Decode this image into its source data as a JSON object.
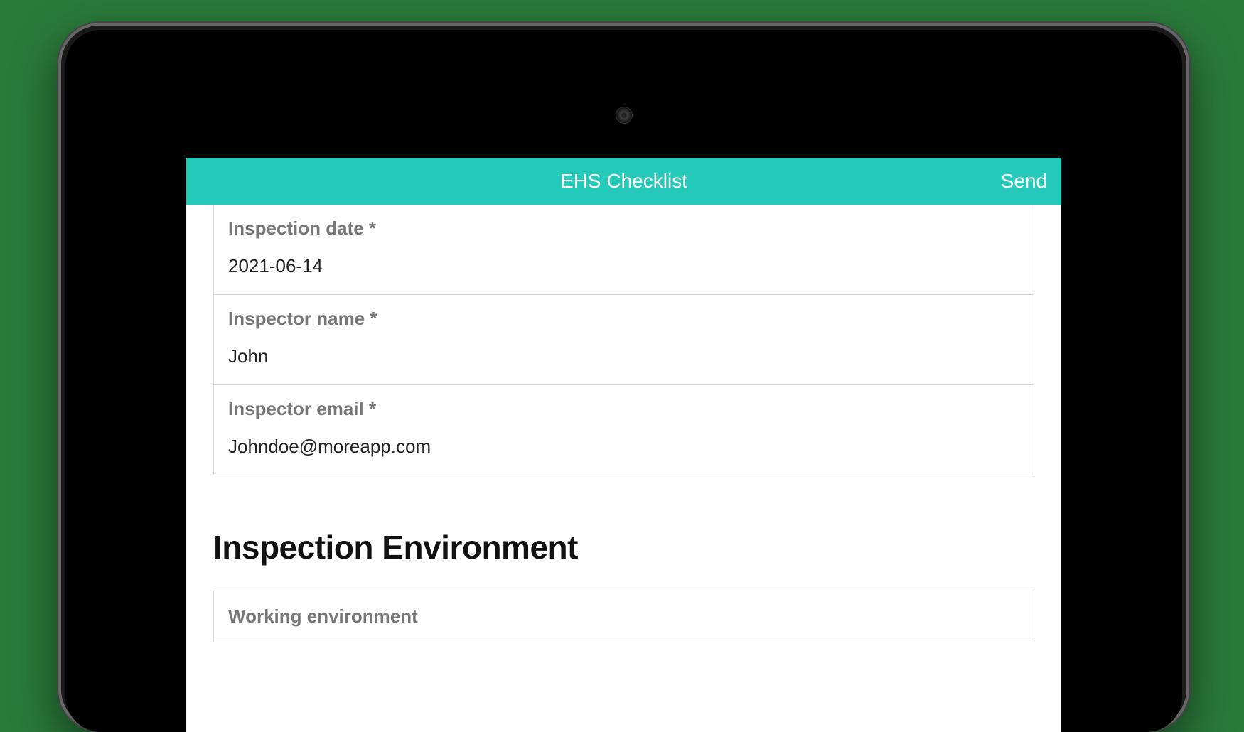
{
  "header": {
    "title": "EHS Checklist",
    "send_label": "Send"
  },
  "form": {
    "fields": [
      {
        "label": "Inspection date *",
        "value": "2021-06-14"
      },
      {
        "label": "Inspector name *",
        "value": "John"
      },
      {
        "label": "Inspector email *",
        "value": "Johndoe@moreapp.com"
      }
    ]
  },
  "section": {
    "heading": "Inspection Environment",
    "first_row_label": "Working environment"
  },
  "colors": {
    "accent": "#24c9ba"
  }
}
